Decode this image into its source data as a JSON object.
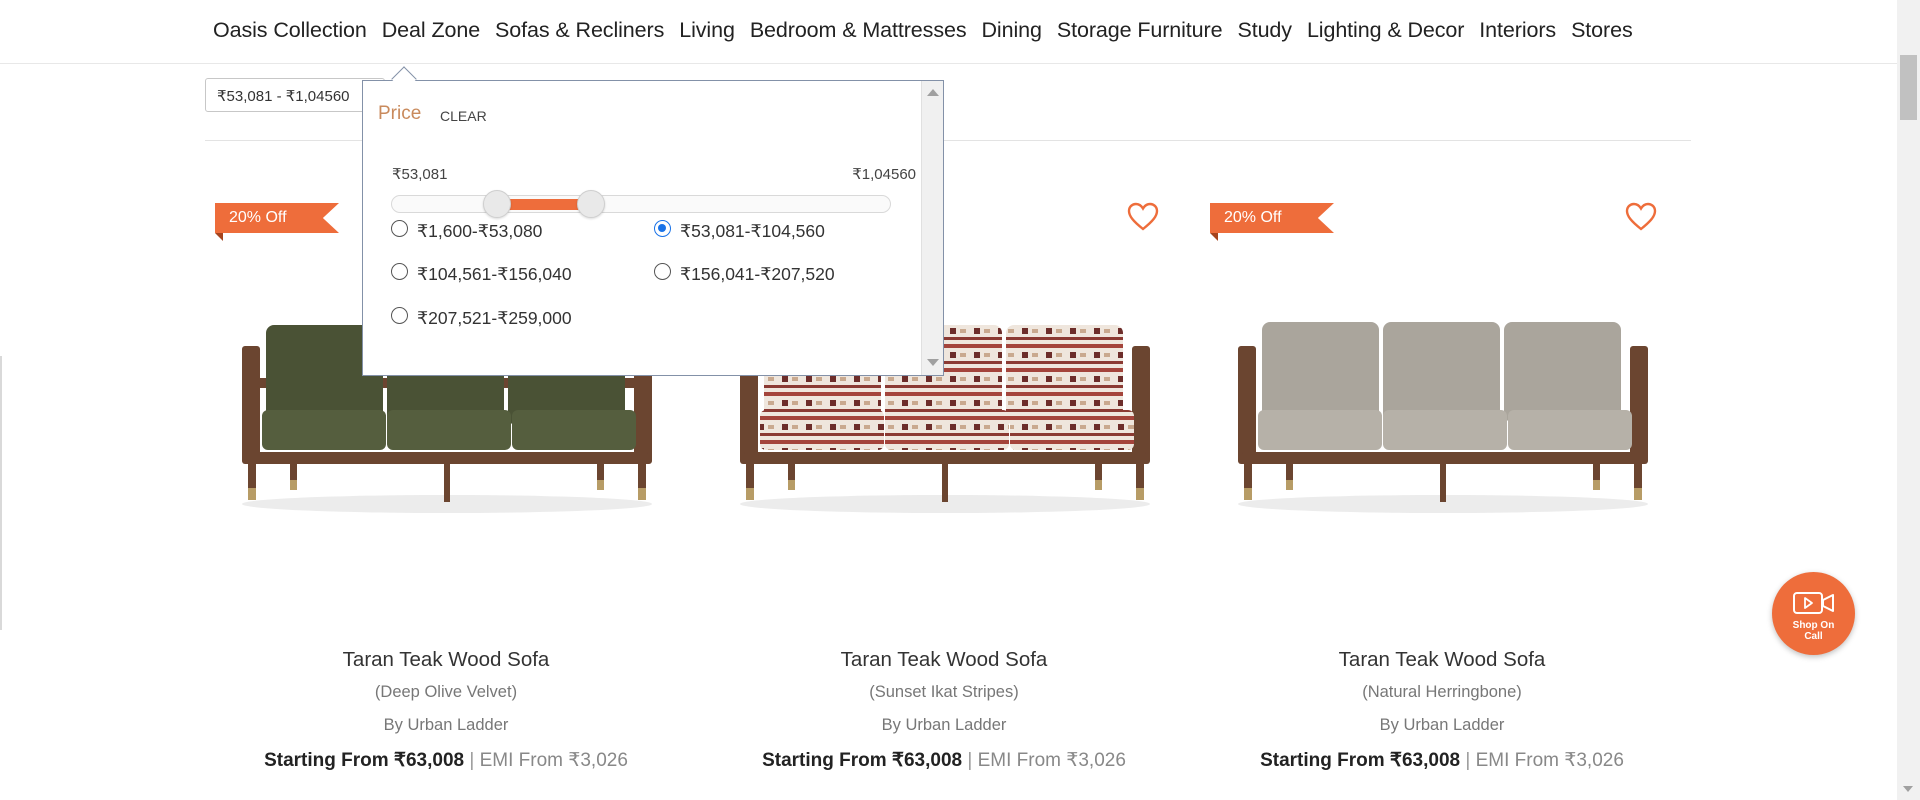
{
  "nav": {
    "items": [
      "Oasis Collection",
      "Deal Zone",
      "Sofas & Recliners",
      "Living",
      "Bedroom & Mattresses",
      "Dining",
      "Storage Furniture",
      "Study",
      "Lighting & Decor",
      "Interiors",
      "Stores"
    ]
  },
  "filter_chip": {
    "label": "₹53,081 - ₹1,04560"
  },
  "price_dropdown": {
    "tab_label": "Price",
    "clear_label": "CLEAR",
    "range_min_label": "₹53,081",
    "range_max_label": "₹1,04560",
    "slider_range_fraction": [
      0.21,
      0.4
    ],
    "options": [
      {
        "label": "₹1,600-₹53,080",
        "selected": false
      },
      {
        "label": "₹53,081-₹104,560",
        "selected": true
      },
      {
        "label": "₹104,561-₹156,040",
        "selected": false
      },
      {
        "label": "₹156,041-₹207,520",
        "selected": false
      },
      {
        "label": "₹207,521-₹259,000",
        "selected": false
      }
    ]
  },
  "products": [
    {
      "badge": "20% Off",
      "title": "Taran Teak Wood Sofa",
      "variant": "(Deep Olive Velvet)",
      "brand": "By Urban Ladder",
      "price_prefix": "Starting From ",
      "price": "₹63,008",
      "emi": "EMI From ₹3,026",
      "upholstery_color": "#4a5235"
    },
    {
      "badge": "",
      "title": "Taran Teak Wood Sofa",
      "variant": "(Sunset Ikat Stripes)",
      "brand": "By Urban Ladder",
      "price_prefix": "Starting From ",
      "price": "₹63,008",
      "emi": "EMI From ₹3,026",
      "upholstery_color": "#e7d9cf"
    },
    {
      "badge": "20% Off",
      "title": "Taran Teak Wood Sofa",
      "variant": "(Natural Herringbone)",
      "brand": "By Urban Ladder",
      "price_prefix": "Starting From ",
      "price": "₹63,008",
      "emi": "EMI From ₹3,026",
      "upholstery_color": "#aaa59c"
    }
  ],
  "shop_on_call": {
    "line1": "Shop On",
    "line2": "Call"
  },
  "colors": {
    "accent": "#ee6d3b",
    "price_tab": "#c98a5c",
    "radio_selected": "#1a73e8",
    "wood": "#6b4530",
    "brass": "#b79c66"
  }
}
